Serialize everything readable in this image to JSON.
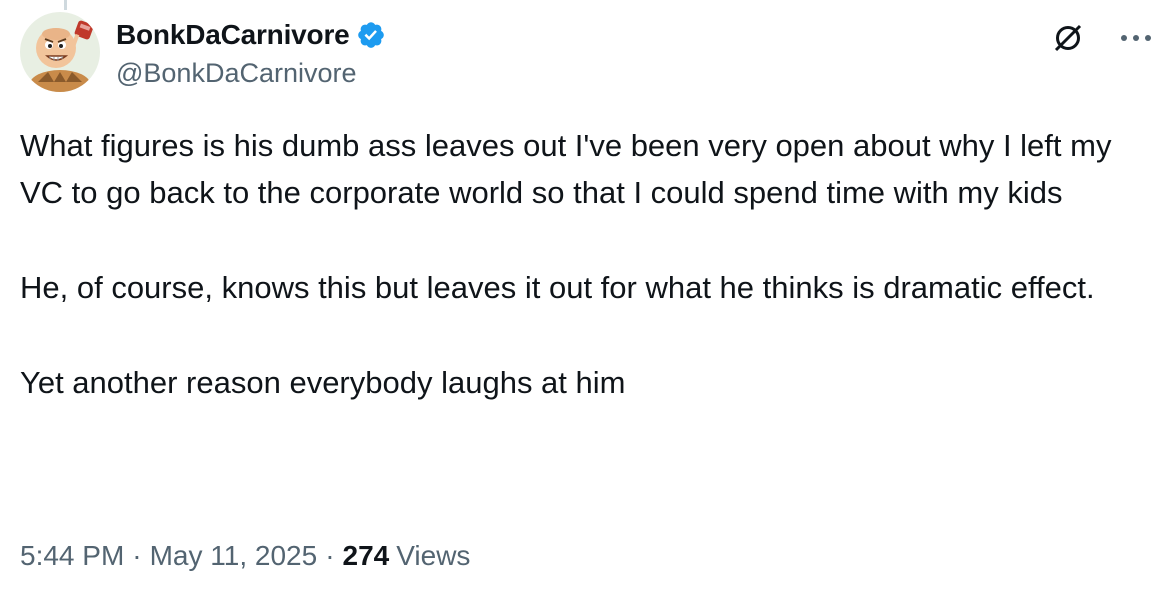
{
  "author": {
    "display_name": "BonkDaCarnivore",
    "handle": "@BonkDaCarnivore",
    "verified": true,
    "verified_icon": "verified-badge-icon",
    "avatar_icon": "cartoon-caveman-avatar"
  },
  "actions": {
    "grok_icon": "grok-icon",
    "more_icon": "more-options-icon"
  },
  "tweet": {
    "paragraphs": [
      "What figures is his dumb ass leaves out I've been very open about why I left my VC to go back to the corporate world so that I could spend time with my kids",
      "He, of course, knows this but leaves it out for what he thinks is dramatic effect.",
      "Yet another reason everybody laughs at him"
    ]
  },
  "meta": {
    "time": "5:44 PM",
    "separator": "·",
    "date": "May 11, 2025",
    "views_count": "274",
    "views_label": "Views"
  },
  "colors": {
    "text_primary": "#0f1419",
    "text_secondary": "#536471",
    "verified_blue": "#1d9bf0"
  }
}
